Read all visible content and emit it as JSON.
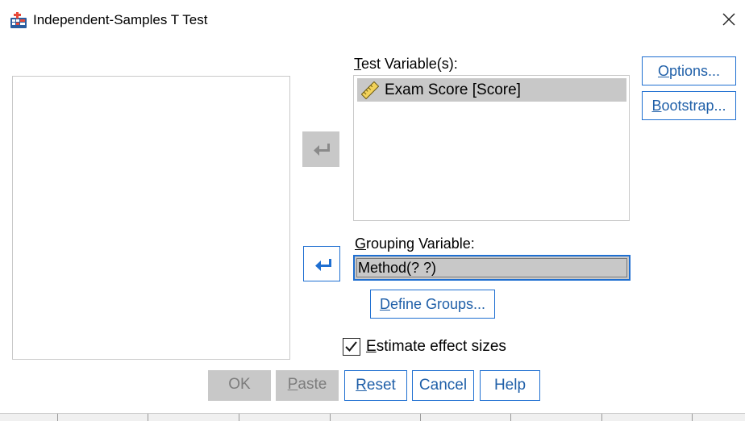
{
  "window": {
    "title": "Independent-Samples T Test"
  },
  "labels": {
    "test_variables_first": "T",
    "test_variables_rest": "est Variable(s):",
    "grouping_first": "G",
    "grouping_rest": "rouping Variable:"
  },
  "test_variables": [
    {
      "label": "Exam Score [Score]",
      "icon": "scale-ruler-icon"
    }
  ],
  "grouping_variable": {
    "value": "Method(? ?)"
  },
  "side_buttons": {
    "options_first": "O",
    "options_rest": "ptions...",
    "bootstrap_first": "B",
    "bootstrap_rest": "ootstrap..."
  },
  "define_groups": {
    "first": "D",
    "rest": "efine Groups..."
  },
  "effect_sizes": {
    "first": "E",
    "rest": "stimate effect sizes",
    "checked": true
  },
  "footer": {
    "ok": "OK",
    "paste_first": "P",
    "paste_rest": "aste",
    "reset_first": "R",
    "reset_rest": "eset",
    "cancel": "Cancel",
    "help": "Help"
  },
  "colors": {
    "accent": "#1f6fd1",
    "selection": "#c8c8c8",
    "link_text": "#1f5fa8"
  }
}
